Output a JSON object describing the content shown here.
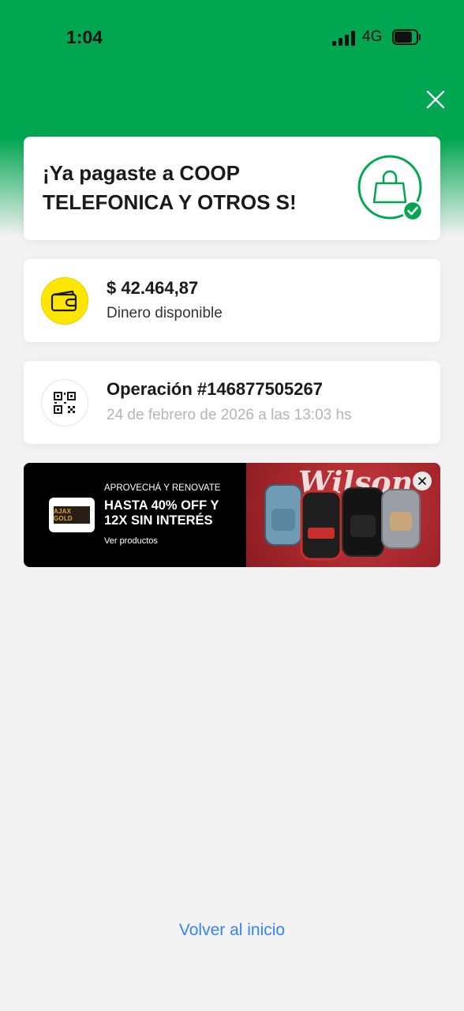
{
  "status_bar": {
    "time": "1:04",
    "network": "4G"
  },
  "colors": {
    "brand_green": "#00a650",
    "link_blue": "#3483fa",
    "wallet_yellow": "#ffe600"
  },
  "success": {
    "title": "¡Ya pagaste a COOP TELEFONICA Y OTROS S!",
    "icon": "shopping-bag-check-icon"
  },
  "balance": {
    "amount": "$ 42.464,87",
    "label": "Dinero disponible",
    "icon": "wallet-icon"
  },
  "operation": {
    "title": "Operación #146877505267",
    "date": "24 de febrero de 2026 a las 13:03 hs",
    "icon": "qr-code-icon"
  },
  "banner": {
    "brand": "AJAX GOLD",
    "eyebrow": "APROVECHÁ Y RENOVATE",
    "headline": "HASTA 40% OFF Y 12X SIN INTERÉS",
    "cta": "Ver productos",
    "image_brand": "Wilson"
  },
  "footer": {
    "back_link": "Volver al inicio"
  }
}
